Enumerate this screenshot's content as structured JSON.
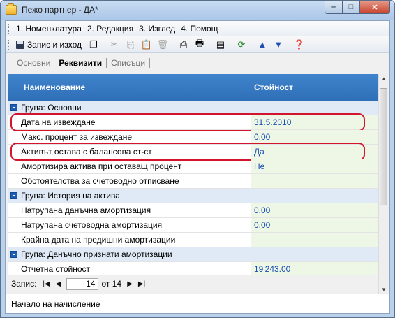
{
  "window": {
    "title": "Пежо партнер - ДА*",
    "min_glyph": "–",
    "max_glyph": "□",
    "close_glyph": "✕"
  },
  "menu": [
    {
      "label": "1. Номенклатура"
    },
    {
      "label": "2. Редакция"
    },
    {
      "label": "3. Изглед"
    },
    {
      "label": "4. Помощ"
    }
  ],
  "toolbar": {
    "save_label": "Запис и изход",
    "icons": [
      "save-icon",
      "copy-window-icon",
      "cut-icon",
      "copy-icon",
      "paste-icon",
      "delete-icon",
      "print-icon",
      "print-preview-icon",
      "report-icon",
      "refresh-icon",
      "arrow-up-icon",
      "arrow-down-icon",
      "help-icon"
    ]
  },
  "tabs": [
    {
      "label": "Основни",
      "active": false
    },
    {
      "label": "Реквизити",
      "active": true
    },
    {
      "label": "Списъци",
      "active": false
    }
  ],
  "grid": {
    "col_name": "Наименование",
    "col_value": "Стойност",
    "rows": [
      {
        "type": "group",
        "name": "Група: Основни"
      },
      {
        "type": "item",
        "name": "Дата на извеждане",
        "value": "31.5.2010",
        "highlight": true
      },
      {
        "type": "item",
        "name": "Макс. процент за извеждане",
        "value": "0.00"
      },
      {
        "type": "item",
        "name": "Активът остава с балансова ст-ст",
        "value": "Да",
        "highlight": true
      },
      {
        "type": "item",
        "name": "Амортизира актива при оставащ процент",
        "value": "Не"
      },
      {
        "type": "item",
        "name": "Обстоятелства за счетоводно отписване",
        "value": ""
      },
      {
        "type": "group",
        "name": "Група: История на актива"
      },
      {
        "type": "item",
        "name": "Натрупана данъчна амортизация",
        "value": "0.00"
      },
      {
        "type": "item",
        "name": "Натрупана счетоводна амортизация",
        "value": "0.00"
      },
      {
        "type": "item",
        "name": "Крайна дата на предишни амортизации",
        "value": ""
      },
      {
        "type": "group",
        "name": "Група: Данъчно признати амортизации"
      },
      {
        "type": "item",
        "name": "Отчетна стойност",
        "value": "19'243.00"
      }
    ]
  },
  "nav": {
    "label": "Запис:",
    "current": "14",
    "total_label": "от 14",
    "first_glyph": "|◀",
    "prev_glyph": "◀",
    "next_glyph": "▶",
    "last_glyph": "▶|"
  },
  "status": {
    "text": "Начало на начисление"
  },
  "colors": {
    "header_bg": "#3a7cc4",
    "value_text": "#1a4fb3",
    "highlight": "#d2152d",
    "value_bg": "#eef6e6"
  }
}
